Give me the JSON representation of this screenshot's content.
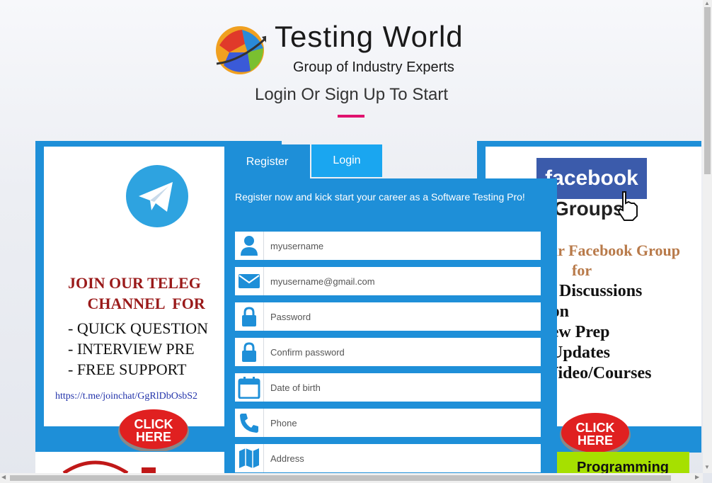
{
  "header": {
    "brand": "Testing World",
    "tagline": "Group of Industry Experts",
    "subtitle": "Login Or Sign Up To Start"
  },
  "left_ad": {
    "title_lines": "JOIN OUR TELEG\n     CHANNEL  FOR",
    "list": "- QUICK QUESTION\n- INTERVIEW PRE\n- FREE SUPPORT",
    "link": "https://t.me/joinchat/GgRlDbOsbS2",
    "click_label": "CLICK HERE"
  },
  "right_ad": {
    "fb_label": "facebook",
    "groups_label": "Groups",
    "line1": "ur Facebook Group",
    "line2": "for",
    "list": "o Discussions\nion\niew Prep\n Updates\nVideo/Courses",
    "click_label": "CLICK HERE",
    "programming_label": "Programming"
  },
  "tabs": {
    "register": "Register",
    "login": "Login"
  },
  "form": {
    "intro": "Register now and kick start your career as a Software Testing Pro!",
    "fields": [
      {
        "placeholder": "myusername",
        "icon": "user-icon"
      },
      {
        "placeholder": "myusername@gmail.com",
        "icon": "envelope-icon"
      },
      {
        "placeholder": "Password",
        "icon": "lock-icon"
      },
      {
        "placeholder": "Confirm password",
        "icon": "lock-icon"
      },
      {
        "placeholder": "Date of birth",
        "icon": "calendar-icon"
      },
      {
        "placeholder": "Phone",
        "icon": "phone-icon"
      },
      {
        "placeholder": "Address",
        "icon": "map-icon"
      }
    ]
  },
  "colors": {
    "accent": "#1e8fd8",
    "login_tab": "#1aa6f0",
    "underline": "#e0126f"
  }
}
